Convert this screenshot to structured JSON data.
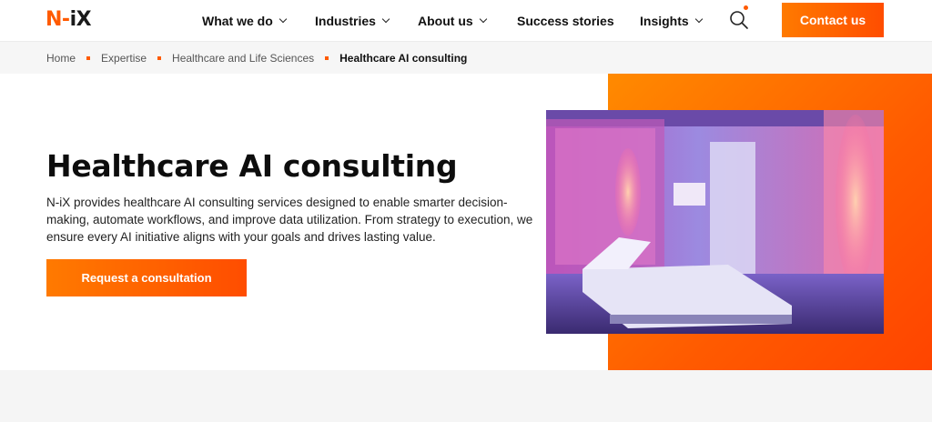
{
  "header": {
    "logo": {
      "n": "N",
      "dash": "-",
      "rest": "iX"
    },
    "nav": [
      {
        "label": "What we do",
        "has_dropdown": true
      },
      {
        "label": "Industries",
        "has_dropdown": true
      },
      {
        "label": "About us",
        "has_dropdown": true
      },
      {
        "label": "Success stories",
        "has_dropdown": false
      },
      {
        "label": "Insights",
        "has_dropdown": true
      }
    ],
    "search_icon": "search-icon",
    "contact_label": "Contact us"
  },
  "breadcrumb": {
    "items": [
      "Home",
      "Expertise",
      "Healthcare and Life Sciences"
    ],
    "current": "Healthcare AI consulting"
  },
  "hero": {
    "title": "Healthcare AI consulting",
    "description": "N-iX provides healthcare AI consulting services designed to enable smarter decision-making, automate workflows, and improve data utilization. From strategy to execution, we ensure every AI initiative aligns with your goals and drives lasting value.",
    "cta_label": "Request a consultation"
  },
  "colors": {
    "accent": "#ff5a00",
    "accent_light": "#ff7a00"
  }
}
